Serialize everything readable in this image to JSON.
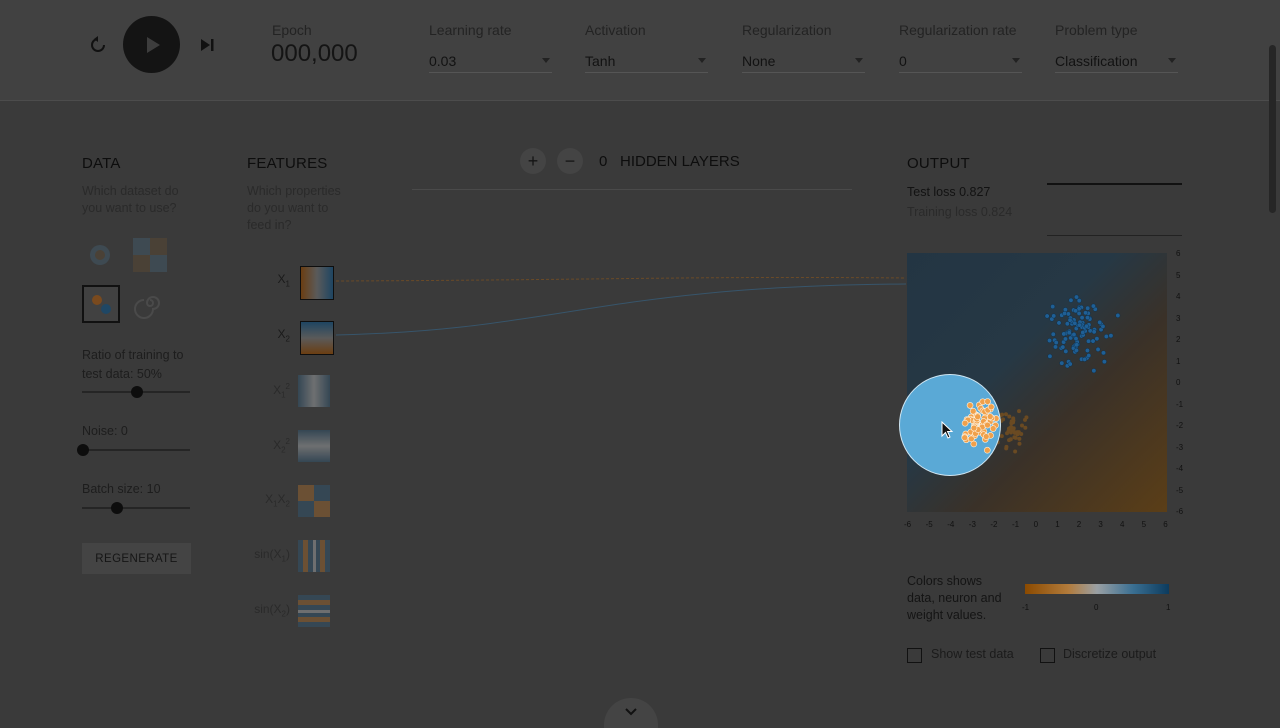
{
  "controls": {
    "reset_icon": "reset-icon",
    "play_icon": "play-icon",
    "step_icon": "step-forward-icon",
    "epoch_label": "Epoch",
    "epoch_value": "000,000"
  },
  "dropdowns": [
    {
      "label": "Learning rate",
      "value": "0.03"
    },
    {
      "label": "Activation",
      "value": "Tanh"
    },
    {
      "label": "Regularization",
      "value": "None"
    },
    {
      "label": "Regularization rate",
      "value": "0"
    },
    {
      "label": "Problem type",
      "value": "Classification"
    }
  ],
  "data_panel": {
    "title": "DATA",
    "subtitle_line1": "Which dataset do",
    "subtitle_line2": "you want to use?",
    "ratio_label_line1": "Ratio of training to",
    "ratio_label_line2": "test data:  50%",
    "noise_label": "Noise:  0",
    "batch_label": "Batch size:  10",
    "regenerate": "REGENERATE"
  },
  "slider_values": {
    "ratio_percent": 50,
    "noise": 0,
    "batch_size": 10
  },
  "features_panel": {
    "title": "FEATURES",
    "subtitle_line1": "Which properties",
    "subtitle_line2": "do you want to",
    "subtitle_line3": "feed in?",
    "features": [
      {
        "base": "X",
        "sub": "1",
        "sup": "",
        "tail": ""
      },
      {
        "base": "X",
        "sub": "2",
        "sup": "",
        "tail": ""
      },
      {
        "base": "X",
        "sub": "1",
        "sup": "2",
        "tail": ""
      },
      {
        "base": "X",
        "sub": "2",
        "sup": "2",
        "tail": ""
      },
      {
        "base": "X",
        "sub": "1",
        "sup": "",
        "tail": "X",
        "tail_sub": "2"
      },
      {
        "base": "sin(X",
        "sub": "1",
        "sup": "",
        "tail": ")"
      },
      {
        "base": "sin(X",
        "sub": "2",
        "sup": "",
        "tail": ")"
      }
    ]
  },
  "network": {
    "add_icon": "+",
    "remove_icon": "−",
    "hidden_count": "0",
    "hidden_label": "HIDDEN LAYERS"
  },
  "output": {
    "title": "OUTPUT",
    "test_loss": "Test loss 0.827",
    "training_loss": "Training loss 0.824",
    "y_ticks": [
      "6",
      "5",
      "4",
      "3",
      "2",
      "1",
      "0",
      "-1",
      "-2",
      "-3",
      "-4",
      "-5",
      "-6"
    ],
    "x_ticks": [
      "-6",
      "-5",
      "-4",
      "-3",
      "-2",
      "-1",
      "0",
      "1",
      "2",
      "3",
      "4",
      "5",
      "6"
    ],
    "legend_text_line1": "Colors shows",
    "legend_text_line2": "data, neuron and",
    "legend_text_line3": "weight values.",
    "legend_min": "-1",
    "legend_mid": "0",
    "legend_max": "1",
    "show_test_data": "Show test data",
    "discretize_output": "Discretize output"
  },
  "colors": {
    "blue_points": "#1f5f95",
    "orange_points": "#f0a04a",
    "highlight": "#5aa9d6"
  },
  "scroll_icon": "chevron-down-icon"
}
